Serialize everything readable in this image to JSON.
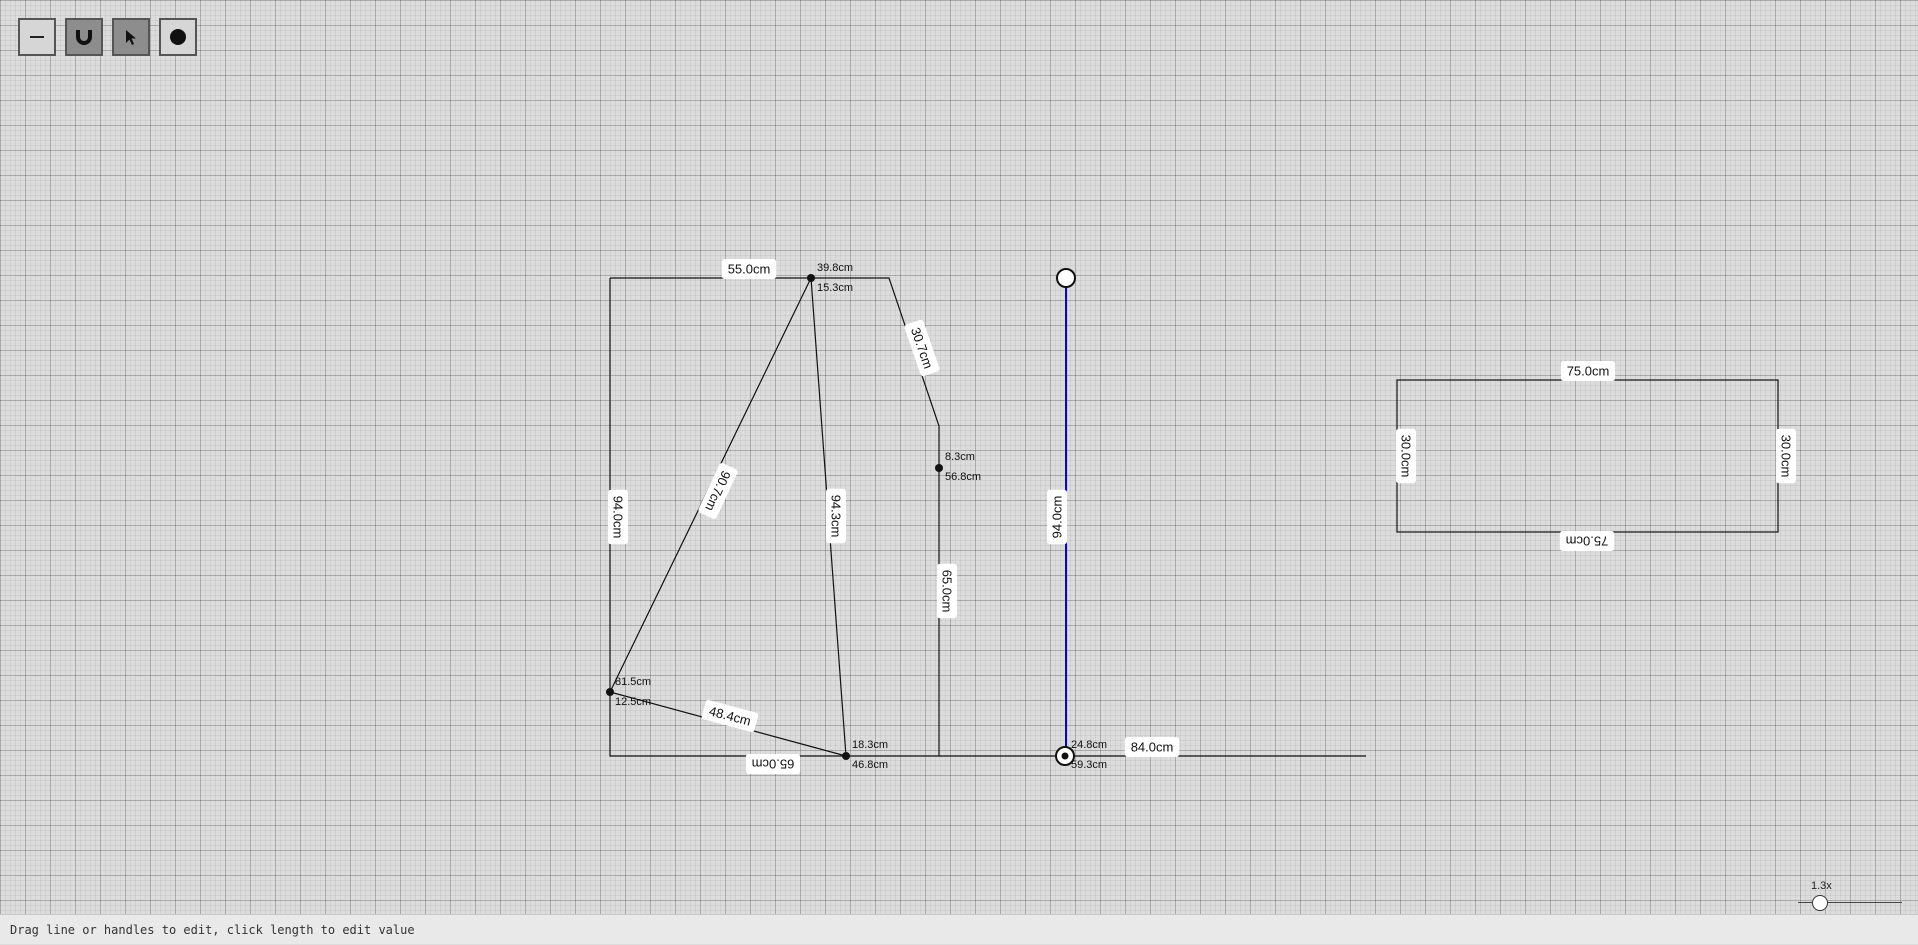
{
  "toolbar": {
    "tools": [
      {
        "name": "line-tool",
        "icon": "line-icon",
        "active": false
      },
      {
        "name": "snap-tool",
        "icon": "magnet-icon",
        "active": true
      },
      {
        "name": "select-tool",
        "icon": "cursor-icon",
        "active": true
      },
      {
        "name": "point-tool",
        "icon": "dot-icon",
        "active": false
      }
    ]
  },
  "colors": {
    "line": "#111111",
    "selected_line": "#0000ee",
    "label_bg": "#ffffff"
  },
  "length_labels": {
    "top_left": "55.0cm",
    "left_vertical": "94.0cm",
    "diagonal_long": "90.7cm",
    "inner_vertical": "94.3cm",
    "slanted_top": "30.7cm",
    "right_vertical": "65.0cm",
    "bottom_segment": "65.0cm",
    "short_diagonal": "48.4cm",
    "selected_vertical": "94.0cm",
    "long_horizontal": "84.0cm",
    "rect_top": "75.0cm",
    "rect_bottom": "75.0cm",
    "rect_left": "30.0cm",
    "rect_right": "30.0cm"
  },
  "point_labels": {
    "p_top": [
      "39.8cm",
      "15.3cm"
    ],
    "p_mid_right": [
      "8.3cm",
      "56.8cm"
    ],
    "p_left": [
      "81.5cm",
      "12.5cm"
    ],
    "p_bottom": [
      "18.3cm",
      "46.8cm"
    ],
    "p_selected": [
      "24.8cm",
      "59.3cm"
    ]
  },
  "zoom": {
    "label": "1.3x",
    "value": 1.3
  },
  "status": "Drag line or handles to edit, click length to edit value"
}
